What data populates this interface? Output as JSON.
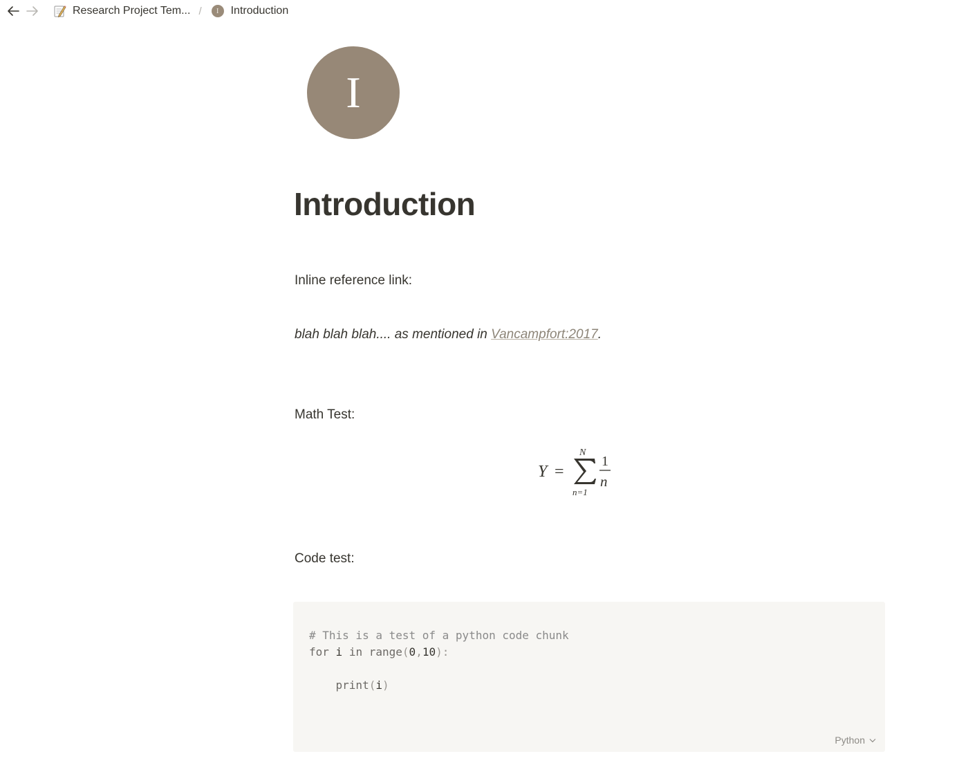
{
  "breadcrumb": {
    "parent_label": "Research Project Tem...",
    "separator": "/",
    "current_label": "Introduction",
    "current_icon_letter": "I"
  },
  "page": {
    "icon_letter": "I",
    "title": "Introduction",
    "accent_color": "#978877"
  },
  "blocks": {
    "inline_ref_label": "Inline reference link:",
    "ref_sentence_prefix": "blah blah blah.... as mentioned in ",
    "ref_link_text": "Vancampfort:2017",
    "ref_sentence_suffix": ".",
    "math_label": "Math Test:",
    "math": {
      "lhs": "Y",
      "equals": "=",
      "sum_upper": "N",
      "sum_lower": "n=1",
      "frac_num": "1",
      "frac_den": "n"
    },
    "code_label": "Code test:"
  },
  "code": {
    "language": "Python",
    "line1_comment": "# This is a test of a python code chunk",
    "line2_kw_for": "for",
    "line2_var": "i",
    "line2_kw_in": "in",
    "line2_fn": "range",
    "line2_arg1": "0",
    "line2_arg2": "10",
    "line3_fn": "print",
    "line3_arg": "i"
  }
}
